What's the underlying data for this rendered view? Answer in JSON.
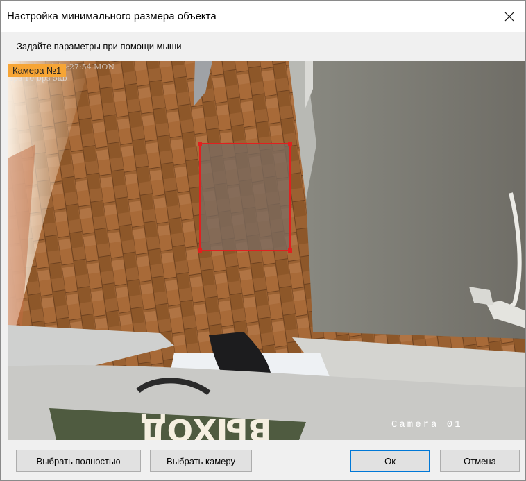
{
  "window": {
    "title": "Настройка минимального размера объекта",
    "hint": "Задайте параметры при помощи мыши"
  },
  "viewer": {
    "camera_badge": "Камера №1",
    "osd_date": "11-24 16:27:54 MON",
    "osd_rate": "fps 10 bps 5kb",
    "camera_label": "Camera 01",
    "sign_text": "ВЫХОД",
    "selection_color": "#e02020"
  },
  "buttons": {
    "select_all": "Выбрать полностью",
    "select_camera": "Выбрать камеру",
    "ok": "Ок",
    "cancel": "Отмена"
  },
  "icons": {
    "close": "close-icon"
  }
}
